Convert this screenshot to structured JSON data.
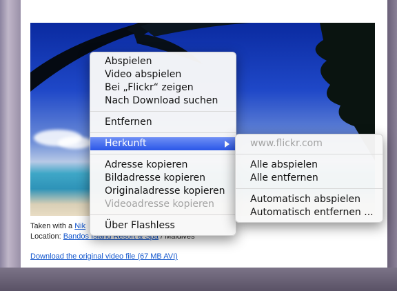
{
  "context_menu": {
    "group1": [
      "Abspielen",
      "Video abspielen",
      "Bei „Flickr“ zeigen",
      "Nach Download suchen"
    ],
    "remove": "Entfernen",
    "origin": "Herkunft",
    "copy_group": [
      {
        "label": "Adresse kopieren",
        "enabled": true
      },
      {
        "label": "Bildadresse kopieren",
        "enabled": true
      },
      {
        "label": "Originaladresse kopieren",
        "enabled": true
      },
      {
        "label": "Videoadresse kopieren",
        "enabled": false
      }
    ],
    "about": "Über Flashless"
  },
  "submenu": {
    "source": "www.flickr.com",
    "group1": [
      "Alle abspielen",
      "Alle entfernen"
    ],
    "group2": [
      "Automatisch abspielen",
      "Automatisch entfernen ..."
    ]
  },
  "page": {
    "taken_prefix": "Taken with a",
    "taken_link": "Nik",
    "location_prefix": "Location:",
    "location_link": "Bandos Island Resort & Spa",
    "location_suffix": "/ Maldives",
    "download_link": "Download the original video file (67 MB AVI)"
  },
  "colors": {
    "selection": "#2a56e8",
    "link": "#1155cc"
  }
}
